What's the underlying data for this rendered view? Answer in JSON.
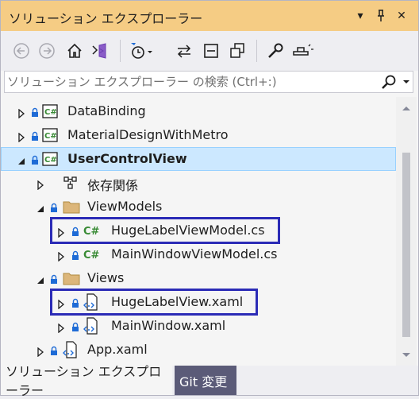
{
  "window": {
    "title": "ソリューション エクスプローラー",
    "dropdown_glyph": "▾",
    "pin_glyph": "⊥",
    "close_glyph": "✕"
  },
  "toolbar": {
    "icons": [
      "back-icon",
      "forward-icon",
      "home-icon",
      "switch-views-icon",
      "pending-changes-filter-icon",
      "sync-icon",
      "collapse-all-icon",
      "show-all-files-icon",
      "properties-icon",
      "preview-icon"
    ]
  },
  "search": {
    "placeholder": "ソリューション エクスプローラー の検索 (Ctrl+:)"
  },
  "tree": [
    {
      "label": "DataBinding",
      "icon": "csharp-project-icon",
      "expanded": false,
      "locked": true
    },
    {
      "label": "MaterialDesignWithMetro",
      "icon": "csharp-project-icon",
      "expanded": false,
      "locked": true
    },
    {
      "label": "UserControlView",
      "icon": "csharp-project-icon",
      "expanded": true,
      "locked": true,
      "selected": true
    },
    {
      "label": "依存関係",
      "icon": "dependencies-icon",
      "expanded": false,
      "locked": false
    },
    {
      "label": "ViewModels",
      "icon": "folder-icon",
      "expanded": true,
      "locked": true
    },
    {
      "label": "HugeLabelViewModel.cs",
      "icon": "csharp-file-icon",
      "expanded": false,
      "locked": true,
      "highlighted": true
    },
    {
      "label": "MainWindowViewModel.cs",
      "icon": "csharp-file-icon",
      "expanded": false,
      "locked": true
    },
    {
      "label": "Views",
      "icon": "folder-icon",
      "expanded": true,
      "locked": true
    },
    {
      "label": "HugeLabelView.xaml",
      "icon": "xaml-file-icon",
      "expanded": false,
      "locked": true,
      "highlighted": true
    },
    {
      "label": "MainWindow.xaml",
      "icon": "xaml-file-icon",
      "expanded": false,
      "locked": true
    },
    {
      "label": "App.xaml",
      "icon": "xaml-file-icon",
      "expanded": false,
      "locked": true
    }
  ],
  "tabs": {
    "solution_explorer": "ソリューション エクスプローラー",
    "git_changes": "Git 変更"
  },
  "colors": {
    "title_bar": "#f5cc84",
    "selection": "#cce8ff",
    "highlight_border": "#2b2bb6",
    "csharp_green": "#388a34",
    "folder_yellow": "#dcb67a",
    "lock_blue": "#1e6bd6"
  }
}
